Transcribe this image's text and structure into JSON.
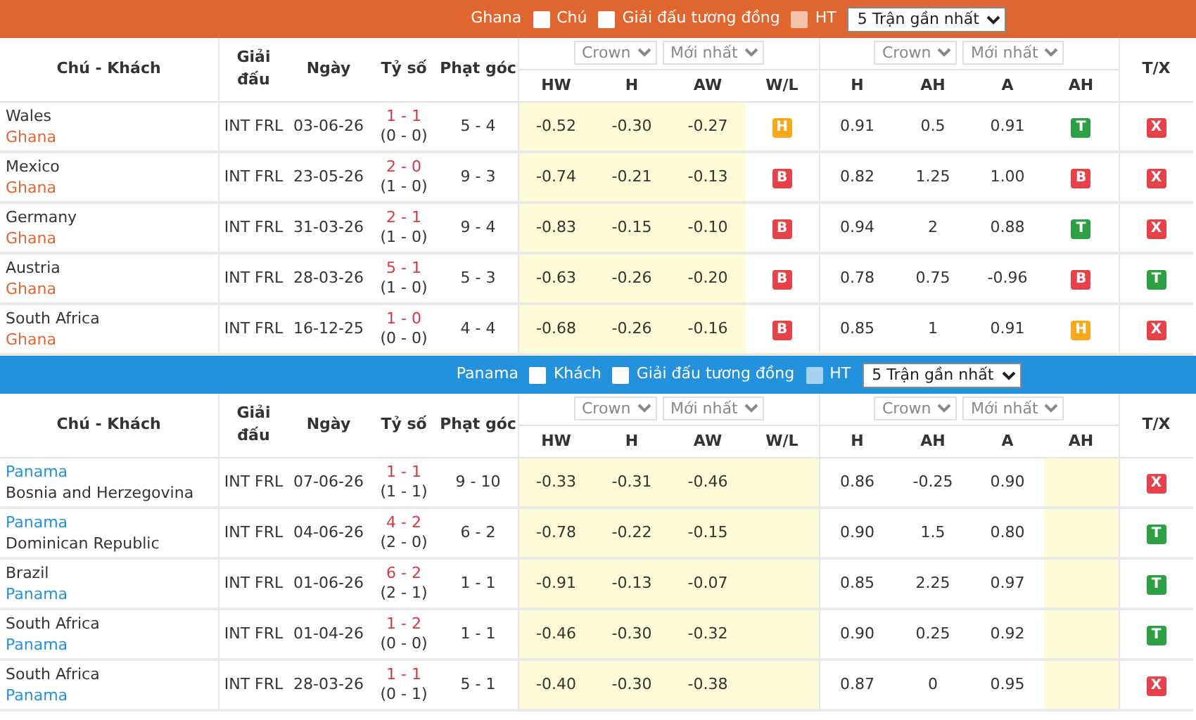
{
  "sections": [
    {
      "color": "#e0662f",
      "team": "Ghana",
      "filters": [
        {
          "label": "Chú",
          "checked": false,
          "disabled": false
        },
        {
          "label": "Giải đấu tương đồng",
          "checked": false,
          "disabled": false
        },
        {
          "label": "HT",
          "checked": false,
          "disabled": true
        }
      ],
      "range": "5 Trận gần nhất",
      "columns": {
        "main": [
          "Chú - Khách",
          "Giải đấu",
          "Ngày",
          "Tỷ số",
          "Phạt góc"
        ],
        "groups": [
          [
            "Crown",
            "Mới nhất"
          ],
          [
            "Crown",
            "Mới nhất"
          ]
        ],
        "last": "T/X",
        "sub": [
          "HW",
          "H",
          "AW",
          "W/L",
          "H",
          "AH",
          "A",
          "AH"
        ]
      },
      "rows": [
        {
          "teams": [
            {
              "name": "Wales",
              "highlighted": false
            },
            {
              "name": "Ghana",
              "highlighted": true
            }
          ],
          "league": "INT FRL",
          "date": "03-06-26",
          "score": "1 - 1",
          "ht_score": "(0 - 0)",
          "corners": "5 - 4",
          "odds_1": [
            "-0.52",
            "-0.30",
            "-0.27"
          ],
          "wl": {
            "text": "H",
            "color": "#f7a81b"
          },
          "odds_2": [
            "0.91",
            "0.5",
            "0.91"
          ],
          "ah": {
            "text": "T",
            "color": "#2ea043"
          },
          "tx": {
            "text": "X",
            "color": "#e5424a"
          }
        },
        {
          "teams": [
            {
              "name": "Mexico",
              "highlighted": false
            },
            {
              "name": "Ghana",
              "highlighted": true
            }
          ],
          "league": "INT FRL",
          "date": "23-05-26",
          "score": "2 - 0",
          "ht_score": "(1 - 0)",
          "corners": "9 - 3",
          "odds_1": [
            "-0.74",
            "-0.21",
            "-0.13"
          ],
          "wl": {
            "text": "B",
            "color": "#e5424a"
          },
          "odds_2": [
            "0.82",
            "1.25",
            "1.00"
          ],
          "ah": {
            "text": "B",
            "color": "#e5424a"
          },
          "tx": {
            "text": "X",
            "color": "#e5424a"
          }
        },
        {
          "teams": [
            {
              "name": "Germany",
              "highlighted": false
            },
            {
              "name": "Ghana",
              "highlighted": true
            }
          ],
          "league": "INT FRL",
          "date": "31-03-26",
          "score": "2 - 1",
          "ht_score": "(1 - 0)",
          "corners": "9 - 4",
          "odds_1": [
            "-0.83",
            "-0.15",
            "-0.10"
          ],
          "wl": {
            "text": "B",
            "color": "#e5424a"
          },
          "odds_2": [
            "0.94",
            "2",
            "0.88"
          ],
          "ah": {
            "text": "T",
            "color": "#2ea043"
          },
          "tx": {
            "text": "X",
            "color": "#e5424a"
          }
        },
        {
          "teams": [
            {
              "name": "Austria",
              "highlighted": false
            },
            {
              "name": "Ghana",
              "highlighted": true
            }
          ],
          "league": "INT FRL",
          "date": "28-03-26",
          "score": "5 - 1",
          "ht_score": "(1 - 0)",
          "corners": "5 - 3",
          "odds_1": [
            "-0.63",
            "-0.26",
            "-0.20"
          ],
          "wl": {
            "text": "B",
            "color": "#e5424a"
          },
          "odds_2": [
            "0.78",
            "0.75",
            "-0.96"
          ],
          "ah": {
            "text": "B",
            "color": "#e5424a"
          },
          "tx": {
            "text": "T",
            "color": "#2ea043"
          }
        },
        {
          "teams": [
            {
              "name": "South Africa",
              "highlighted": false
            },
            {
              "name": "Ghana",
              "highlighted": true
            }
          ],
          "league": "INT FRL",
          "date": "16-12-25",
          "score": "1 - 0",
          "ht_score": "(0 - 0)",
          "corners": "4 - 4",
          "odds_1": [
            "-0.68",
            "-0.26",
            "-0.16"
          ],
          "wl": {
            "text": "B",
            "color": "#e5424a"
          },
          "odds_2": [
            "0.85",
            "1",
            "0.91"
          ],
          "ah": {
            "text": "H",
            "color": "#f7a81b"
          },
          "tx": {
            "text": "X",
            "color": "#e5424a"
          }
        }
      ]
    },
    {
      "color": "#2491dc",
      "team": "Panama",
      "filters": [
        {
          "label": "Khách",
          "checked": false,
          "disabled": false
        },
        {
          "label": "Giải đấu tương đồng",
          "checked": false,
          "disabled": false
        },
        {
          "label": "HT",
          "checked": false,
          "disabled": true
        }
      ],
      "range": "5 Trận gần nhất",
      "columns": {
        "main": [
          "Chú - Khách",
          "Giải đấu",
          "Ngày",
          "Tỷ số",
          "Phạt góc"
        ],
        "groups": [
          [
            "Crown",
            "Mới nhất"
          ],
          [
            "Crown",
            "Mới nhất"
          ]
        ],
        "last": "T/X",
        "sub": [
          "HW",
          "H",
          "AW",
          "W/L",
          "H",
          "AH",
          "A",
          "AH"
        ]
      },
      "rows": [
        {
          "teams": [
            {
              "name": "Panama",
              "highlighted": true
            },
            {
              "name": "Bosnia and Herzegovina",
              "highlighted": false
            }
          ],
          "league": "INT FRL",
          "date": "07-06-26",
          "score": "1 - 1",
          "ht_score": "(1 - 1)",
          "corners": "9 - 10",
          "odds_1": [
            "-0.33",
            "-0.31",
            "-0.46"
          ],
          "odds_2": [
            "0.86",
            "-0.25",
            "0.90"
          ],
          "tx": {
            "text": "X",
            "color": "#e5424a"
          }
        },
        {
          "teams": [
            {
              "name": "Panama",
              "highlighted": true
            },
            {
              "name": "Dominican Republic",
              "highlighted": false
            }
          ],
          "league": "INT FRL",
          "date": "04-06-26",
          "score": "4 - 2",
          "ht_score": "(2 - 0)",
          "corners": "6 - 2",
          "odds_1": [
            "-0.78",
            "-0.22",
            "-0.15"
          ],
          "odds_2": [
            "0.90",
            "1.5",
            "0.80"
          ],
          "tx": {
            "text": "T",
            "color": "#2ea043"
          }
        },
        {
          "teams": [
            {
              "name": "Brazil",
              "highlighted": false
            },
            {
              "name": "Panama",
              "highlighted": true
            }
          ],
          "league": "INT FRL",
          "date": "01-06-26",
          "score": "6 - 2",
          "ht_score": "(2 - 1)",
          "corners": "1 - 1",
          "odds_1": [
            "-0.91",
            "-0.13",
            "-0.07"
          ],
          "odds_2": [
            "0.85",
            "2.25",
            "0.97"
          ],
          "tx": {
            "text": "T",
            "color": "#2ea043"
          }
        },
        {
          "teams": [
            {
              "name": "South Africa",
              "highlighted": false
            },
            {
              "name": "Panama",
              "highlighted": true
            }
          ],
          "league": "INT FRL",
          "date": "01-04-26",
          "score": "1 - 2",
          "ht_score": "(0 - 0)",
          "corners": "1 - 1",
          "odds_1": [
            "-0.46",
            "-0.30",
            "-0.32"
          ],
          "odds_2": [
            "0.90",
            "0.25",
            "0.92"
          ],
          "tx": {
            "text": "T",
            "color": "#2ea043"
          }
        },
        {
          "teams": [
            {
              "name": "South Africa",
              "highlighted": false
            },
            {
              "name": "Panama",
              "highlighted": true
            }
          ],
          "league": "INT FRL",
          "date": "28-03-26",
          "score": "1 - 1",
          "ht_score": "(0 - 1)",
          "corners": "5 - 1",
          "odds_1": [
            "-0.40",
            "-0.30",
            "-0.38"
          ],
          "odds_2": [
            "0.87",
            "0",
            "0.95"
          ],
          "tx": {
            "text": "X",
            "color": "#e5424a"
          }
        }
      ]
    }
  ]
}
